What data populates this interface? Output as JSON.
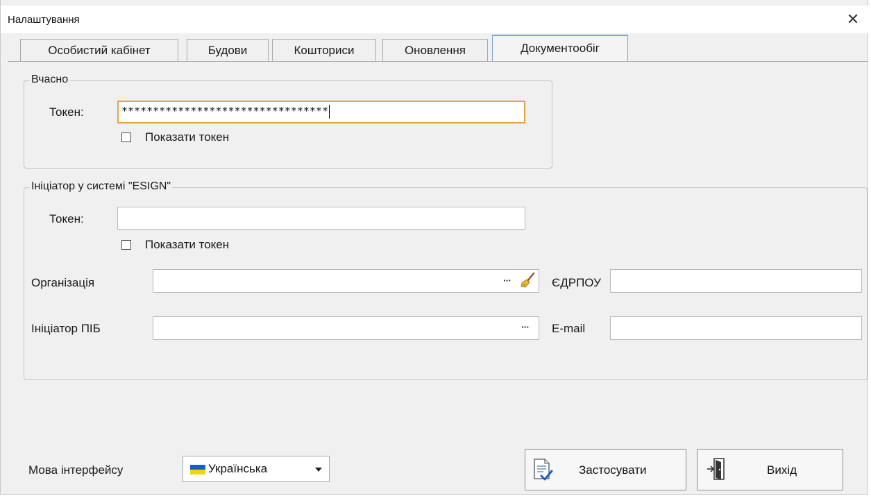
{
  "window": {
    "title": "Налаштування",
    "close_glyph": "✕"
  },
  "tabs": [
    {
      "label": "Особистий кабінет",
      "active": false
    },
    {
      "label": "Будови",
      "active": false
    },
    {
      "label": "Кошториси",
      "active": false
    },
    {
      "label": "Оновлення",
      "active": false
    },
    {
      "label": "Документообіг",
      "active": true
    }
  ],
  "vchasno": {
    "legend": "Вчасно",
    "token_label": "Токен:",
    "token_value": "*********************************",
    "show_token_label": "Показати токен",
    "show_token_checked": false
  },
  "esign": {
    "legend": "Ініціатор у системі \"ESIGN\"",
    "token_label": "Токен:",
    "token_value": "",
    "show_token_label": "Показати токен",
    "show_token_checked": false,
    "organization_label": "Організація",
    "organization_value": "",
    "edrpou_label": "ЄДРПОУ",
    "edrpou_value": "",
    "initiator_label": "Ініціатор ПІБ",
    "initiator_value": "",
    "email_label": "E-mail",
    "email_value": "",
    "ellipsis_glyph": "···"
  },
  "footer": {
    "language_label": "Мова інтерфейсу",
    "language_value": "Українська",
    "apply_label": "Застосувати",
    "exit_label": "Вихід"
  },
  "colors": {
    "focus_border": "#e8a23c",
    "active_tab_border": "#7da2ce",
    "flag_blue": "#1560c8",
    "flag_yellow": "#f5d20a"
  },
  "icons": {
    "close": "close-icon",
    "broom": "broom-icon",
    "apply": "document-check-icon",
    "exit": "door-exit-icon",
    "flag": "ukraine-flag-icon",
    "dropdown": "chevron-down-icon"
  }
}
